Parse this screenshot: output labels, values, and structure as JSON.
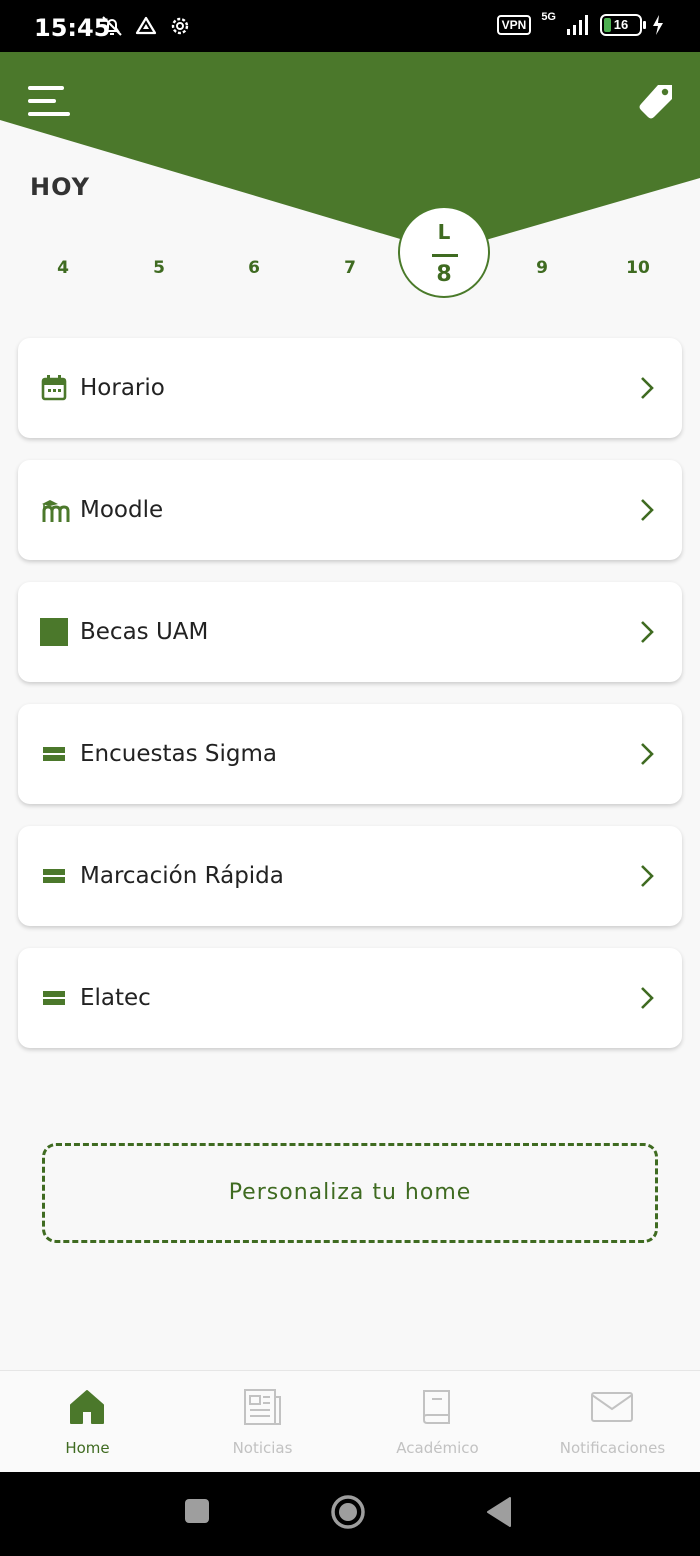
{
  "status_bar": {
    "time": "15:45",
    "vpn": "VPN",
    "network": "5G",
    "battery": "16"
  },
  "header": {
    "today_label": "HOY",
    "accent": "#4b782b"
  },
  "calendar": {
    "days": [
      "4",
      "5",
      "6",
      "7",
      "9",
      "10"
    ],
    "today": {
      "weekday": "L",
      "day": "8"
    }
  },
  "cards": [
    {
      "label": "Horario",
      "icon": "calendar-icon"
    },
    {
      "label": "Moodle",
      "icon": "moodle-icon"
    },
    {
      "label": "Becas UAM",
      "icon": "square-icon"
    },
    {
      "label": "Encuestas Sigma",
      "icon": "bars-icon"
    },
    {
      "label": "Marcación Rápida",
      "icon": "bars-icon"
    },
    {
      "label": "Elatec",
      "icon": "bars-icon"
    }
  ],
  "customize_label": "Personaliza tu home",
  "bottom_nav": [
    {
      "label": "Home",
      "icon": "home-icon",
      "active": true
    },
    {
      "label": "Noticias",
      "icon": "newspaper-icon",
      "active": false
    },
    {
      "label": "Académico",
      "icon": "book-icon",
      "active": false
    },
    {
      "label": "Notificaciones",
      "icon": "mail-icon",
      "active": false
    }
  ]
}
